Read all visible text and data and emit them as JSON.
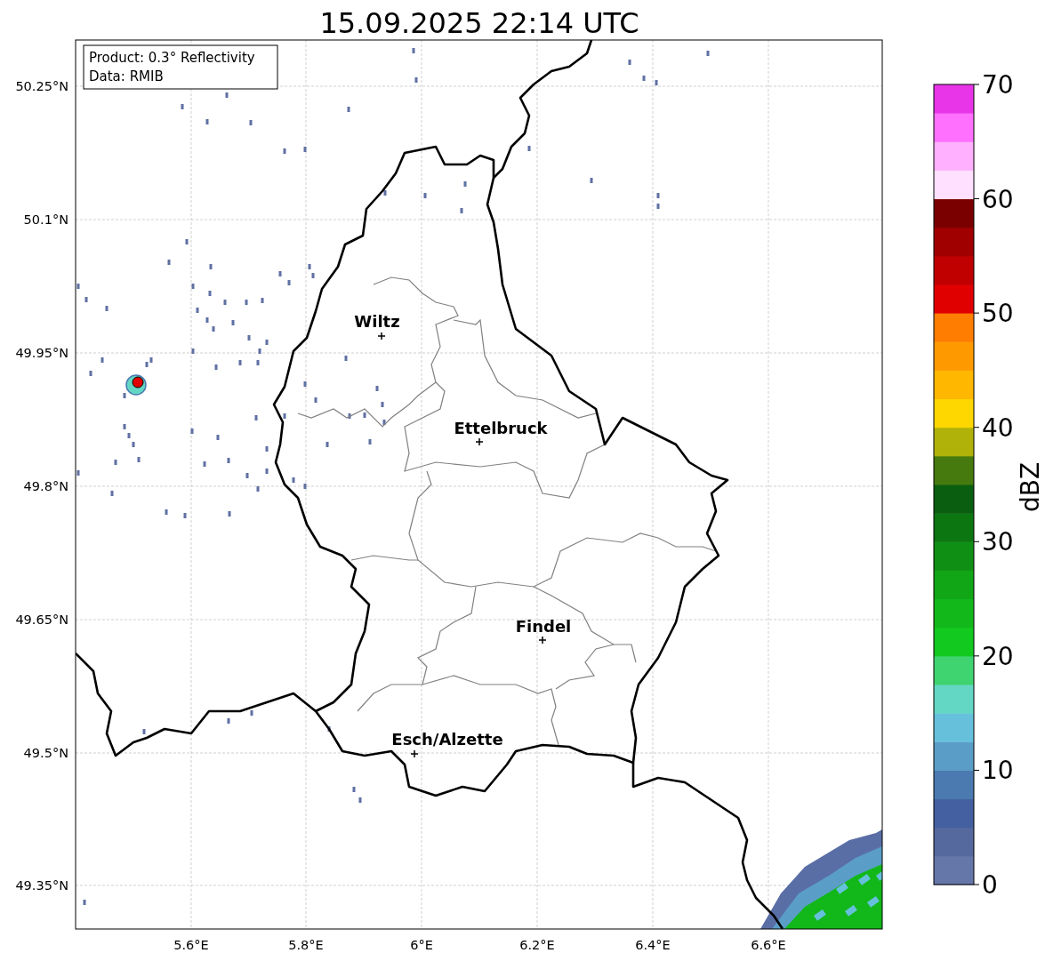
{
  "title": "15.09.2025 22:14 UTC",
  "info_box": {
    "lines": [
      "Product: 0.3° Reflectivity",
      "Data: RMIB"
    ]
  },
  "map": {
    "y_ticks": [
      "50.25°N",
      "50.1°N",
      "49.95°N",
      "49.8°N",
      "49.65°N",
      "49.5°N",
      "49.35°N"
    ],
    "x_ticks": [
      "5.6°E",
      "5.8°E",
      "6°E",
      "6.2°E",
      "6.4°E",
      "6.6°E"
    ],
    "cities": [
      {
        "name": "Wiltz"
      },
      {
        "name": "Ettelbruck"
      },
      {
        "name": "Findel"
      },
      {
        "name": "Esch/Alzette"
      }
    ]
  },
  "colorbar": {
    "label": "dBZ",
    "ticks": [
      "70",
      "60",
      "50",
      "40",
      "30",
      "20",
      "10",
      "0"
    ],
    "segments": [
      {
        "color": "#6577a8"
      },
      {
        "color": "#56699f"
      },
      {
        "color": "#4560a0"
      },
      {
        "color": "#4a7ab0"
      },
      {
        "color": "#5a9ec7"
      },
      {
        "color": "#66c0dc"
      },
      {
        "color": "#63d7c4"
      },
      {
        "color": "#3fd46f"
      },
      {
        "color": "#12c91f"
      },
      {
        "color": "#12b81a"
      },
      {
        "color": "#10a616"
      },
      {
        "color": "#0f8f13"
      },
      {
        "color": "#0c7611"
      },
      {
        "color": "#0a5e0f"
      },
      {
        "color": "#467a0e"
      },
      {
        "color": "#b0b20a"
      },
      {
        "color": "#ffd700"
      },
      {
        "color": "#ffb700"
      },
      {
        "color": "#ff9900"
      },
      {
        "color": "#ff7d00"
      },
      {
        "color": "#e00000"
      },
      {
        "color": "#c00000"
      },
      {
        "color": "#a00000"
      },
      {
        "color": "#7a0000"
      },
      {
        "color": "#ffe0ff"
      },
      {
        "color": "#ffb0ff"
      },
      {
        "color": "#ff70ff"
      },
      {
        "color": "#e835e8"
      }
    ]
  }
}
